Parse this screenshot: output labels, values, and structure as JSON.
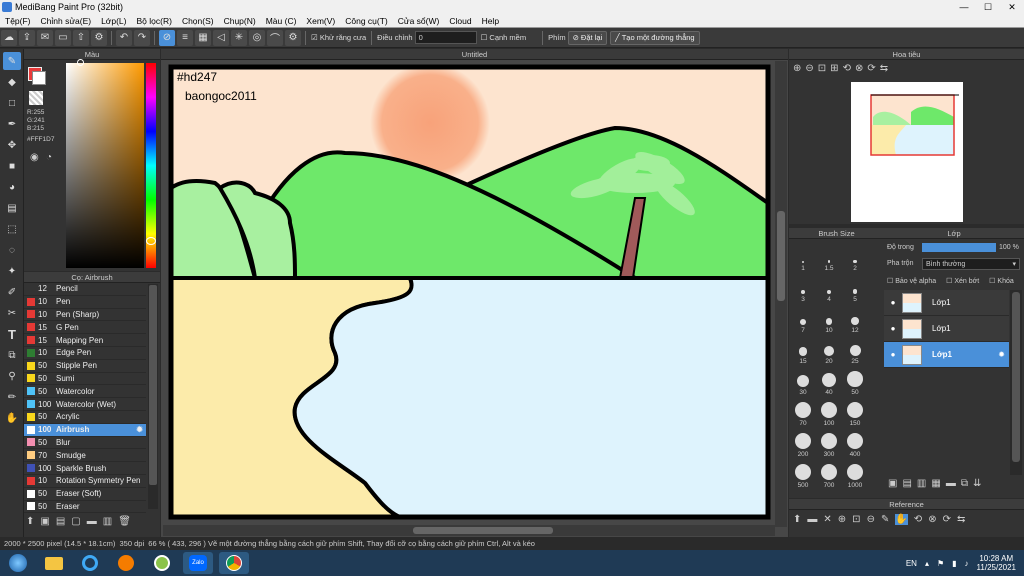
{
  "window": {
    "title": "MediBang Paint Pro (32bit)",
    "minimize": "—",
    "maximize": "☐",
    "close": "✕"
  },
  "menu": [
    "Tệp(F)",
    "Chỉnh sửa(E)",
    "Lớp(L)",
    "Bộ lọc(R)",
    "Chọn(S)",
    "Chụp(N)",
    "Màu (C)",
    "Xem(V)",
    "Công cụ(T)",
    "Cửa sổ(W)",
    "Cloud",
    "Help"
  ],
  "toolbar": {
    "antialias_label": "Khử răng cưa",
    "correction_label": "Điều chỉnh",
    "correction_value": "0",
    "edge_label": "Cạnh mềm",
    "key_label": "Phím",
    "reset_label": "Đặt lại",
    "line_label": "Tạo một đường thẳng"
  },
  "color_panel": {
    "title": "Màu",
    "r": "R:255",
    "g": "G:241",
    "b": "B:215",
    "hex": "#FFF1D7",
    "primary_color": "#ffffff",
    "secondary_color": "#e83a3a"
  },
  "brush_panel": {
    "title": "Cọ: Airbrush",
    "brushes": [
      {
        "size": "12",
        "name": "Pencil",
        "color": "#333333"
      },
      {
        "size": "10",
        "name": "Pen",
        "color": "#e53935"
      },
      {
        "size": "10",
        "name": "Pen (Sharp)",
        "color": "#e53935"
      },
      {
        "size": "15",
        "name": "G Pen",
        "color": "#e53935"
      },
      {
        "size": "15",
        "name": "Mapping Pen",
        "color": "#e53935"
      },
      {
        "size": "10",
        "name": "Edge Pen",
        "color": "#2e7d32"
      },
      {
        "size": "50",
        "name": "Stipple Pen",
        "color": "#f9d71c"
      },
      {
        "size": "50",
        "name": "Sumi",
        "color": "#f9d71c"
      },
      {
        "size": "50",
        "name": "Watercolor",
        "color": "#4fc3f7"
      },
      {
        "size": "100",
        "name": "Watercolor (Wet)",
        "color": "#4fc3f7"
      },
      {
        "size": "50",
        "name": "Acrylic",
        "color": "#f9d71c"
      },
      {
        "size": "100",
        "name": "Airbrush",
        "color": "#ffffff",
        "selected": true
      },
      {
        "size": "50",
        "name": "Blur",
        "color": "#f48fb1"
      },
      {
        "size": "70",
        "name": "Smudge",
        "color": "#ffcc80"
      },
      {
        "size": "100",
        "name": "Sparkle Brush",
        "color": "#3f51b5"
      },
      {
        "size": "10",
        "name": "Rotation Symmetry Pen",
        "color": "#e53935"
      },
      {
        "size": "50",
        "name": "Eraser (Soft)",
        "color": "#ffffff"
      },
      {
        "size": "50",
        "name": "Eraser",
        "color": "#ffffff"
      }
    ]
  },
  "canvas": {
    "tab": "Untitled",
    "text1": "#hd247",
    "text2": "baongoc2011",
    "sky_color": "#fde4cf",
    "sun_color": "#f9a77c",
    "hill_color": "#6ee86a",
    "light_hill_color": "#a8f0a0",
    "sand_color": "#fcebaa",
    "water_color": "#def3fd"
  },
  "navigator": {
    "title": "Hoa tiêu"
  },
  "brush_size": {
    "title": "Brush Size",
    "sizes": [
      "1",
      "1.5",
      "2",
      "3",
      "4",
      "5",
      "7",
      "10",
      "12",
      "15",
      "20",
      "25",
      "30",
      "40",
      "50",
      "70",
      "100",
      "150",
      "200",
      "300",
      "400",
      "500",
      "700",
      "1000"
    ]
  },
  "layer_panel": {
    "title": "Lớp",
    "opacity_label": "Độ trong",
    "opacity_value": "100 %",
    "opacity_fraction": 1.0,
    "blend_label": "Pha trộn",
    "blend_value": "Bình thường",
    "protect_alpha": "Bảo vệ alpha",
    "clipping": "Xén bớt",
    "lock": "Khóa",
    "layers": [
      {
        "name": "Lớp1",
        "selected": false
      },
      {
        "name": "Lớp1",
        "selected": false
      },
      {
        "name": "Lớp1",
        "selected": true
      }
    ]
  },
  "reference": {
    "title": "Reference"
  },
  "status": {
    "size": "2000 * 2500 pixel",
    "physical": "(14.5 * 18.1cm)",
    "dpi": "350 dpi",
    "zoom": "66 %",
    "coords": "( 433, 296 )",
    "hint": "Vẽ một đường thẳng bằng cách giữ phím Shift, Thay đổi cỡ cọ bằng cách giữ phím Ctrl, Alt và kéo"
  },
  "taskbar": {
    "lang": "EN",
    "time": "10:28 AM",
    "date": "11/25/2021",
    "zalo": "Zalo"
  }
}
